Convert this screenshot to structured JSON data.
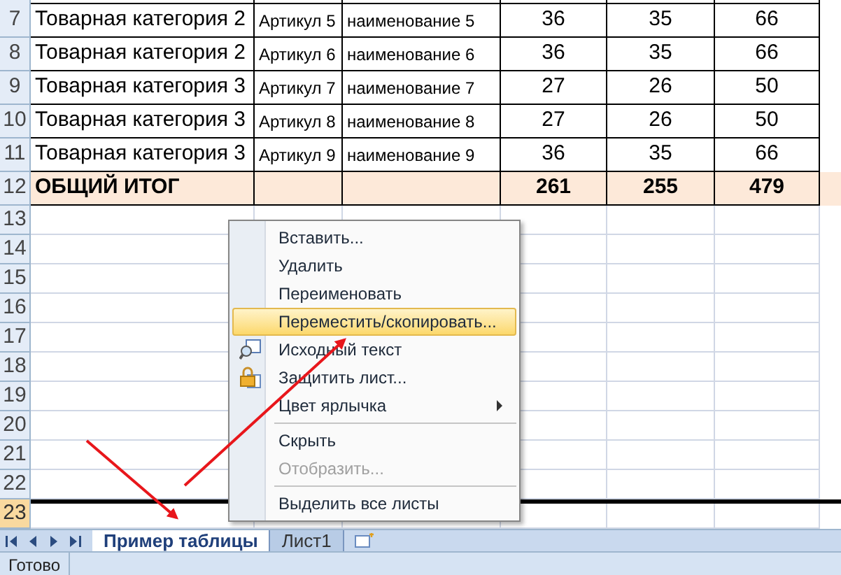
{
  "rows": [
    {
      "num": "7",
      "kind": "data",
      "cells": [
        "Товарная категория 2",
        "Артикул 5",
        "наименование 5",
        "36",
        "35",
        "66"
      ]
    },
    {
      "num": "8",
      "kind": "data",
      "cells": [
        "Товарная категория 2",
        "Артикул 6",
        "наименование 6",
        "36",
        "35",
        "66"
      ]
    },
    {
      "num": "9",
      "kind": "data",
      "cells": [
        "Товарная категория 3",
        "Артикул 7",
        "наименование 7",
        "27",
        "26",
        "50"
      ]
    },
    {
      "num": "10",
      "kind": "data",
      "cells": [
        "Товарная категория 3",
        "Артикул 8",
        "наименование 8",
        "27",
        "26",
        "50"
      ]
    },
    {
      "num": "11",
      "kind": "data",
      "cells": [
        "Товарная категория 3",
        "Артикул 9",
        "наименование 9",
        "36",
        "35",
        "66"
      ]
    },
    {
      "num": "12",
      "kind": "total",
      "cells": [
        "ОБЩИЙ ИТОГ",
        "",
        "",
        "261",
        "255",
        "479"
      ]
    }
  ],
  "empty_rows": [
    {
      "num": "13",
      "selected": false
    },
    {
      "num": "14",
      "selected": false
    },
    {
      "num": "15",
      "selected": false
    },
    {
      "num": "16",
      "selected": false
    },
    {
      "num": "17",
      "selected": false
    },
    {
      "num": "18",
      "selected": false
    },
    {
      "num": "19",
      "selected": false
    },
    {
      "num": "20",
      "selected": false
    },
    {
      "num": "21",
      "selected": false
    },
    {
      "num": "22",
      "selected": false
    },
    {
      "num": "23",
      "selected": true
    }
  ],
  "context_menu": [
    [
      {
        "label": "Вставить...",
        "kind": "plain",
        "selected": false,
        "disabled": false
      },
      {
        "label": "Удалить",
        "kind": "plain",
        "selected": false,
        "disabled": false
      },
      {
        "label": "Переименовать",
        "kind": "plain",
        "selected": false,
        "disabled": false
      },
      {
        "label": "Переместить/скопировать...",
        "kind": "plain",
        "selected": true,
        "disabled": false
      },
      {
        "label": "Исходный текст",
        "kind": "code",
        "selected": false,
        "disabled": false
      },
      {
        "label": "Защитить лист...",
        "kind": "lock",
        "selected": false,
        "disabled": false
      },
      {
        "label": "Цвет ярлычка",
        "kind": "submenu",
        "selected": false,
        "disabled": false
      }
    ],
    [
      {
        "label": "Скрыть",
        "kind": "plain",
        "selected": false,
        "disabled": false
      },
      {
        "label": "Отобразить...",
        "kind": "plain",
        "selected": false,
        "disabled": true
      }
    ],
    [
      {
        "label": "Выделить все листы",
        "kind": "plain",
        "selected": false,
        "disabled": false
      }
    ]
  ],
  "sheet_tabs": [
    {
      "label": "Пример таблицы",
      "selected": true
    },
    {
      "label": "Лист1",
      "selected": false
    }
  ],
  "status_bar": {
    "text": "Готово"
  }
}
